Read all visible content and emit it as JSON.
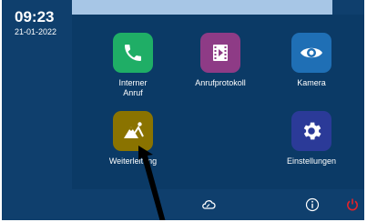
{
  "status": {
    "time": "09:23",
    "date": "21-01-2022"
  },
  "tiles": [
    {
      "label_lines": [
        "Interner",
        "Anruf"
      ],
      "icon": "phone-icon",
      "color": "#1fae66"
    },
    {
      "label_lines": [
        "Anrufprotokoll"
      ],
      "icon": "film-log-icon",
      "color": "#8e3b86"
    },
    {
      "label_lines": [
        "Kamera"
      ],
      "icon": "eye-icon",
      "color": "#1f6fb5"
    },
    {
      "label_lines": [
        "Weiterleitung"
      ],
      "icon": "mountain-icon",
      "color": "#8a7300"
    },
    {
      "label_lines": [
        "Einstellungen"
      ],
      "icon": "gear-icon",
      "color": "#2b3a98"
    }
  ],
  "bottom_bar": {
    "icons": [
      "cloud-icon",
      "info-icon",
      "power-icon"
    ],
    "power_color": "#e2232a"
  }
}
